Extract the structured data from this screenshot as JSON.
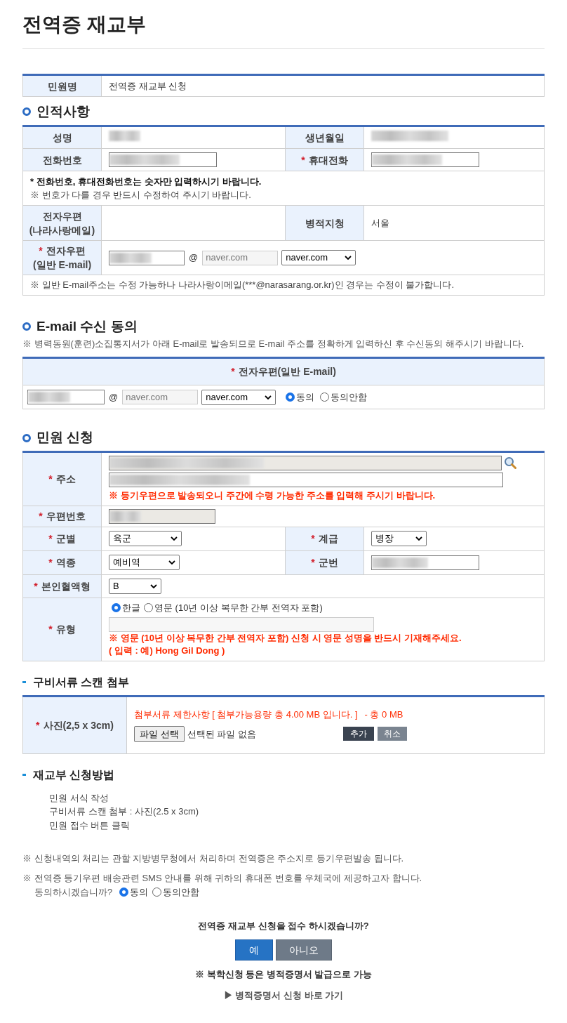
{
  "page_title": "전역증 재교부",
  "application": {
    "label": "민원명",
    "value": "전역증 재교부 신청"
  },
  "personal": {
    "heading": "인적사항",
    "name": {
      "label": "성명"
    },
    "birth": {
      "label": "생년월일"
    },
    "phone": {
      "label": "전화번호"
    },
    "mobile": {
      "label": "휴대전화",
      "mark": "*"
    },
    "notes": [
      {
        "text": "* 전화번호, 휴대전화번호는 숫자만 입력하시기 바랍니다.",
        "bold": true
      },
      {
        "text": "※ 번호가 다를 경우 반드시 수정하여 주시기 바랍니다.",
        "bold": false
      }
    ],
    "nara_mail": {
      "label_lines": [
        "전자우편",
        "(나라사랑메일)"
      ]
    },
    "office": {
      "label": "병적지청",
      "value": "서울"
    },
    "email": {
      "label_lines": [
        "전자우편",
        "(일반 E-mail)"
      ],
      "mark": "*",
      "at": "@",
      "domain": "naver.com",
      "select": "naver.com"
    },
    "email_note": "※ 일반 E-mail주소는 수정 가능하나 나라사랑이메일(***@narasarang.or.kr)인 경우는 수정이 불가합니다."
  },
  "email_consent": {
    "heading": "E-mail 수신 동의",
    "note": "※ 병력동원(훈련)소집통지서가 아래 E-mail로 발송되므로 E-mail 주소를 정확하게 입력하신 후 수신동의 해주시기 바랍니다.",
    "column": {
      "label": "전자우편(일반 E-mail)",
      "mark": "*"
    },
    "at": "@",
    "domain": "naver.com",
    "select": "naver.com",
    "options": [
      {
        "label": "동의",
        "selected": true
      },
      {
        "label": "동의안함",
        "selected": false
      }
    ]
  },
  "request": {
    "heading": "민원 신청",
    "address": {
      "label": "주소",
      "mark": "*",
      "note": "※ 등기우편으로 발송되오니 주간에 수령 가능한 주소를 입력해 주시기 바랍니다."
    },
    "postal": {
      "label": "우편번호",
      "mark": "*"
    },
    "branch": {
      "label": "군별",
      "mark": "*",
      "value": "육군"
    },
    "rank": {
      "label": "계급",
      "mark": "*",
      "value": "병장"
    },
    "service": {
      "label": "역종",
      "mark": "*",
      "value": "예비역"
    },
    "service_no": {
      "label": "군번",
      "mark": "*"
    },
    "blood": {
      "label": "본인혈액형",
      "mark": "*",
      "value": "B"
    },
    "type": {
      "label": "유형",
      "mark": "*",
      "options": [
        {
          "label": "한글",
          "selected": true
        },
        {
          "label": "영문 (10년 이상 복무한 간부 전역자 포함)",
          "selected": false
        }
      ],
      "notes": [
        "※ 영문 (10년 이상 복무한 간부 전역자 포함) 신청 시 영문 성명을 반드시 기재해주세요.",
        "( 입력 : 예) Hong Gil Dong )"
      ]
    }
  },
  "attachments": {
    "heading": "구비서류 스캔 첨부",
    "photo": {
      "label": "사진(2,5 x 3cm)",
      "mark": "*"
    },
    "limit": "첨부서류 제한사항 [ 첨부가능용량 총 4.00 MB 입니다. ]",
    "total": "- 총 0 MB",
    "file_button": "파일 선택",
    "file_status": "선택된 파일 없음",
    "add_button": "추가",
    "cancel_button": "취소"
  },
  "method": {
    "heading": "재교부 신청방법",
    "steps": [
      "민원 서식 작성",
      "구비서류 스캔 첨부 : 사진(2.5 x 3cm)",
      "민원 접수 버튼 클릭"
    ]
  },
  "notices": [
    "※ 신청내역의 처리는 관할 지방병무청에서 처리하며 전역증은 주소지로 등기우편발송 됩니다.",
    "※ 전역증 등기우편 배송관련 SMS 안내를 위해 귀하의 휴대폰 번호를 우체국에 제공하고자 합니다."
  ],
  "sms_consent": {
    "question": "동의하시겠습니까?",
    "options": [
      {
        "label": "동의",
        "selected": true
      },
      {
        "label": "동의안함",
        "selected": false
      }
    ]
  },
  "confirm": {
    "question": "전역증 재교부 신청을 접수 하시겠습니까?",
    "yes": "예",
    "no": "아니오",
    "note": "※ 복학신청 등은 병적증명서 발급으로 가능",
    "link": "▶ 병적증명서 신청 바로 가기"
  }
}
